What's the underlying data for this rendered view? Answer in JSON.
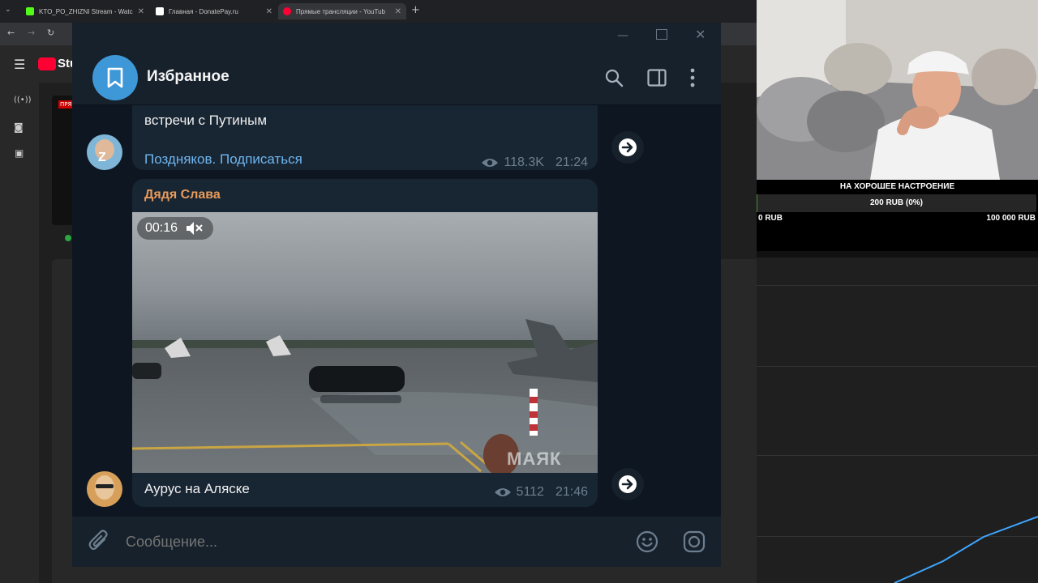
{
  "browser": {
    "tabs": [
      {
        "title": "KTO_PO_ZHIZNI Stream - Watc",
        "fav_color": "#53fc18"
      },
      {
        "title": "Главная - DonatePay.ru",
        "fav_color": "#ffffff"
      },
      {
        "title": "Прямые трансляции - YouTub",
        "fav_color": "#ff0033"
      }
    ],
    "new_tab": "+"
  },
  "youtube": {
    "logo_text": "Stu",
    "badge": "ПРЯ"
  },
  "telegram": {
    "chat_title": "Избранное",
    "messages": [
      {
        "text": "встречи с Путиным",
        "link": "Поздняков. Подписаться",
        "views": "118.3K",
        "time": "21:24"
      },
      {
        "author": "Дядя Слава",
        "video_time": "00:16",
        "caption": "Аурус на Аляске",
        "views": "5112",
        "time": "21:46",
        "watermark": "МАЯК"
      }
    ],
    "compose_placeholder": "Сообщение..."
  },
  "donation": {
    "title": "НА ХОРОШЕЕ НАСТРОЕНИЕ",
    "progress_text": "200 RUB (0%)",
    "progress_fraction": 0.002,
    "min_label": "0 RUB",
    "max_label": "100 000 RUB"
  },
  "colors": {
    "accent": "#3e98d8",
    "author": "#e89b5a",
    "link": "#6fb6ef"
  }
}
